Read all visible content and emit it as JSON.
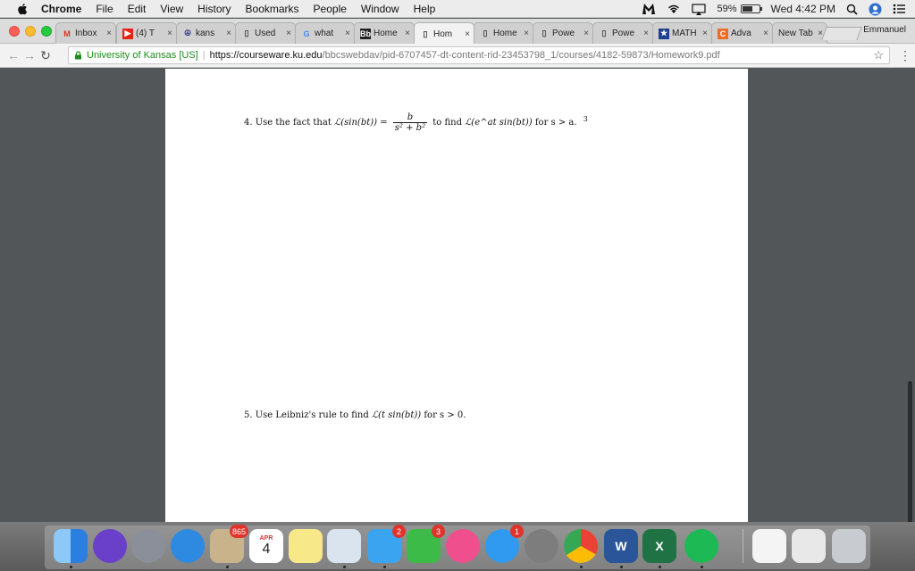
{
  "menubar": {
    "app_name": "Chrome",
    "items": [
      "File",
      "Edit",
      "View",
      "History",
      "Bookmarks",
      "People",
      "Window",
      "Help"
    ],
    "battery_percent": "59%",
    "battery_level": 0.59,
    "clock": "Wed 4:42 PM"
  },
  "tabs": [
    {
      "label": "Inbox",
      "icon": "gmail-icon"
    },
    {
      "label": "(4) T",
      "icon": "youtube-icon"
    },
    {
      "label": "kans",
      "icon": "peace-icon"
    },
    {
      "label": "Used",
      "icon": "document-icon"
    },
    {
      "label": "what",
      "icon": "google-icon"
    },
    {
      "label": "Home",
      "icon": "bb-icon"
    },
    {
      "label": "Hom",
      "icon": "document-icon",
      "active": true
    },
    {
      "label": "Home",
      "icon": "document-icon"
    },
    {
      "label": "Powe",
      "icon": "document-icon"
    },
    {
      "label": "Powe",
      "icon": "document-icon"
    },
    {
      "label": "MATH",
      "icon": "star-icon"
    },
    {
      "label": "Adva",
      "icon": "chegg-icon"
    },
    {
      "label": "New Tab",
      "icon": ""
    }
  ],
  "profile_name": "Emmanuel",
  "omnibox": {
    "site_identity": "University of Kansas [US]",
    "url_host": "https://courseware.ku.edu",
    "url_path": "/bbcswebdav/pid-6707457-dt-content-rid-23453798_1/courses/4182-59873/Homework9.pdf"
  },
  "document": {
    "problem4": {
      "number": "4.",
      "pre": "Use the fact that",
      "lhs": "ℒ(sin(bt)) =",
      "frac_num": "b",
      "frac_den": "s² + b²",
      "mid": "to find",
      "target": "ℒ(e^at sin(bt))",
      "cond": "for s > a.",
      "points": "3"
    },
    "problem5": {
      "number": "5.",
      "text": "Use Leibniz's rule to find",
      "target": "ℒ(t sin(bt))",
      "cond": "for s > 0."
    }
  },
  "dock": {
    "items": [
      {
        "name": "Finder",
        "color": "#3b8be8"
      },
      {
        "name": "Siri",
        "color": "#6a3fc9"
      },
      {
        "name": "Launchpad",
        "color": "#8a8f9a"
      },
      {
        "name": "Safari",
        "color": "#2d8ae0"
      },
      {
        "name": "Mail",
        "color": "#c9b38a",
        "badge": "865"
      },
      {
        "name": "Calendar",
        "color": "#ffffff",
        "month": "APR",
        "day": "4"
      },
      {
        "name": "Notes",
        "color": "#f7e88a"
      },
      {
        "name": "Preview",
        "color": "#d9e4ef"
      },
      {
        "name": "Messages",
        "color": "#3aa4f0",
        "badge": "2"
      },
      {
        "name": "FaceTime",
        "color": "#3dbb48",
        "badge": "3"
      },
      {
        "name": "iTunes",
        "color": "#ef4f8c"
      },
      {
        "name": "App Store",
        "color": "#2f9af0",
        "badge": "1"
      },
      {
        "name": "System Preferences",
        "color": "#7d7d7d"
      },
      {
        "name": "Chrome",
        "color": "#ffffff"
      },
      {
        "name": "Word",
        "color": "#2a5699",
        "letter": "W"
      },
      {
        "name": "Excel",
        "color": "#1f7244",
        "letter": "X"
      },
      {
        "name": "Spotify",
        "color": "#1db954"
      },
      {
        "name": "Document",
        "color": "#f4f4f4"
      },
      {
        "name": "Excel Document",
        "color": "#e8e8e8"
      },
      {
        "name": "Trash",
        "color": "#c8ccd0"
      }
    ]
  }
}
